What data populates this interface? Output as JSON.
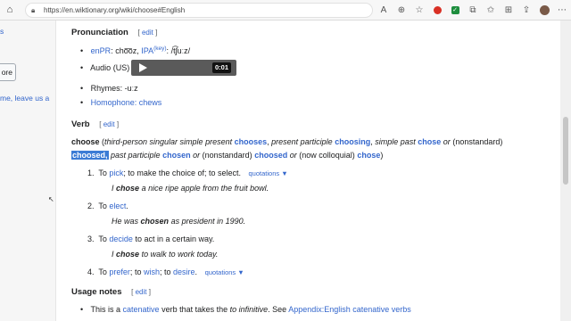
{
  "browser": {
    "url": "https://en.wiktionary.org/wiki/choose#English"
  },
  "sidebar": {
    "line1": "s",
    "button_label": "ore",
    "line2": "me, leave us a"
  },
  "pronunciation": {
    "heading": "Pronunciation",
    "edit_label": "edit",
    "enpr_label": "enPR",
    "enpr_value": "cho͞oz",
    "ipa_label": "IPA",
    "key_label": "(key)",
    "ipa_value": "/t͡ʃuːz/",
    "audio_label": "Audio (US)",
    "audio_time": "0:01",
    "rhymes_label": "Rhymes: -uːz",
    "homophone_label": "Homophone:",
    "homophone_word": "chews"
  },
  "verb": {
    "heading": "Verb",
    "edit_label": "edit",
    "headword": "choose",
    "third_person": "third-person singular simple present",
    "chooses": "chooses",
    "pres_part": "present participle",
    "choosing": "choosing",
    "simple_past": "simple past",
    "chose": "chose",
    "or": "or",
    "nonstandard": "(nonstandard)",
    "choosed_hl": "choosed,",
    "past_part": "past participle",
    "chosen": "chosen",
    "choosed": "choosed",
    "colloquial": "(now colloquial)",
    "chose2": "chose"
  },
  "definitions": [
    {
      "num": "1.",
      "pre": "To",
      "link": "pick",
      "post": "; to make the choice of; to select.",
      "quot": "quotations ▼",
      "example_pre": "I",
      "example_bold": "chose",
      "example_post": "a nice ripe apple from the fruit bowl."
    },
    {
      "num": "2.",
      "pre": "To",
      "link": "elect",
      "post": ".",
      "example_pre": "He was",
      "example_bold": "chosen",
      "example_post": "as president in 1990."
    },
    {
      "num": "3.",
      "pre": "To",
      "link": "decide",
      "post": "to act in a certain way.",
      "example_pre": "I",
      "example_bold": "chose",
      "example_post": "to walk to work today."
    },
    {
      "num": "4.",
      "pre": "To",
      "link": "prefer",
      "sep1": ";",
      "sep2": "to",
      "link2": "wish",
      "sep3": "; to",
      "link3": "desire",
      "post": ".",
      "quot": "quotations ▼"
    }
  ],
  "usage": {
    "heading": "Usage notes",
    "edit_label": "edit",
    "pre": "This is a",
    "link": "catenative",
    "mid": "verb that takes the",
    "italic": "to infinitive",
    "see": ". See",
    "link2": "Appendix:English catenative verbs"
  }
}
